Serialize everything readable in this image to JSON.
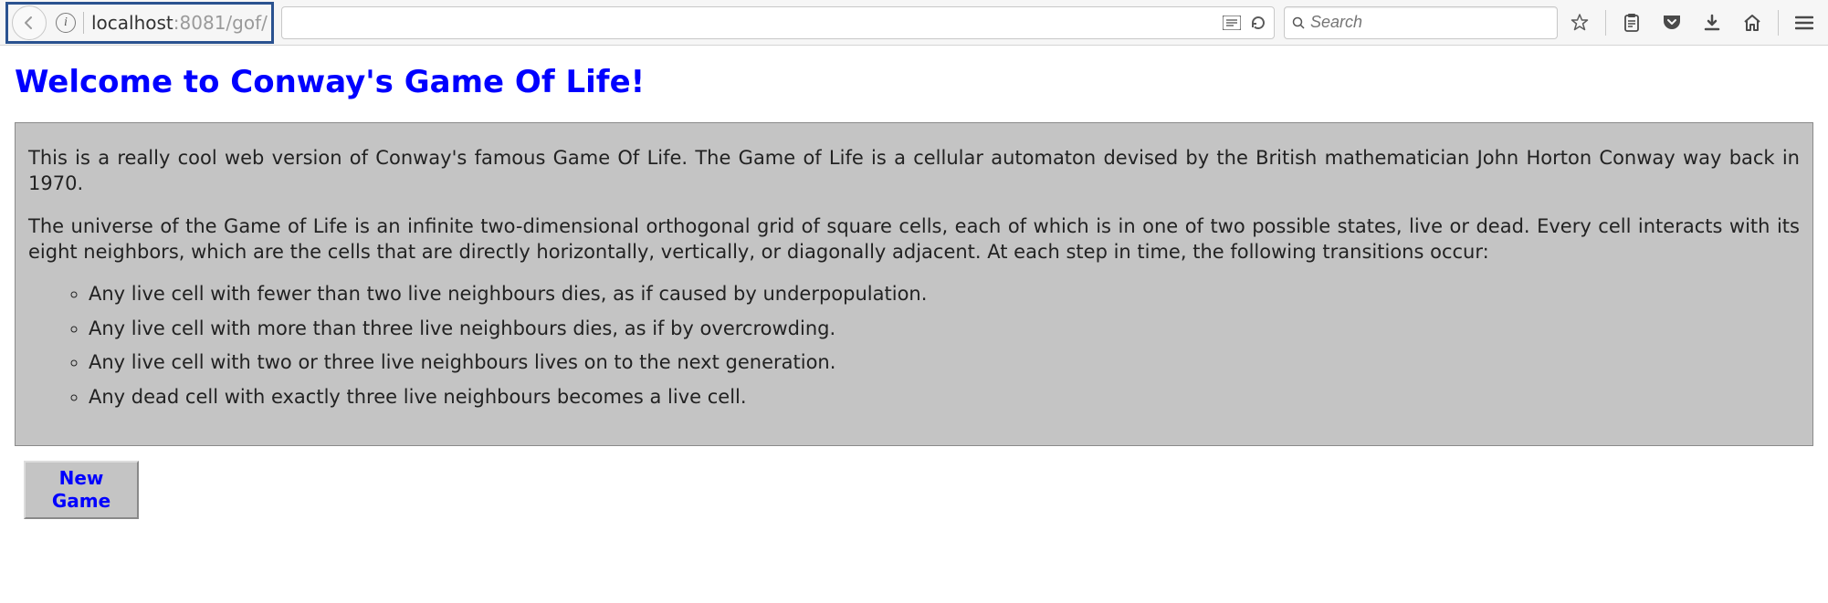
{
  "toolbar": {
    "url_host": "localhost",
    "url_port_path": ":8081/gof/",
    "search_placeholder": "Search"
  },
  "page": {
    "title": "Welcome to Conway's Game Of Life!",
    "para1": "This is a really cool web version of Conway's famous Game Of Life. The Game of Life is a cellular automaton devised by the British mathematician John Horton Conway way back in 1970.",
    "para2": "The universe of the Game of Life is an infinite two-dimensional orthogonal grid of square cells, each of which is in one of two possible states, live or dead. Every cell interacts with its eight neighbors, which are the cells that are directly horizontally, vertically, or diagonally adjacent. At each step in time, the following transitions occur:",
    "rules": [
      "Any live cell with fewer than two live neighbours dies, as if caused by underpopulation.",
      "Any live cell with more than three live neighbours dies, as if by overcrowding.",
      "Any live cell with two or three live neighbours lives on to the next generation.",
      "Any dead cell with exactly three live neighbours becomes a live cell."
    ],
    "new_game_label": "New\nGame"
  }
}
